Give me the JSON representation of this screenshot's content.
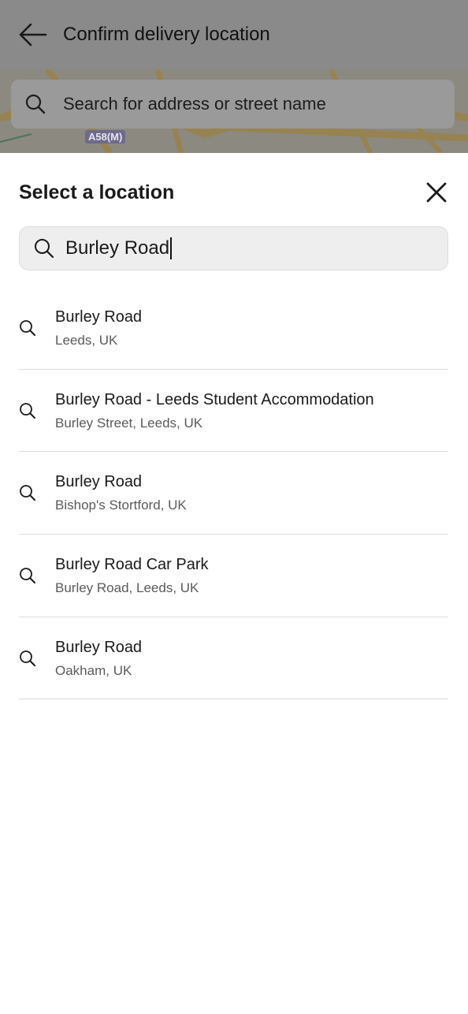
{
  "header": {
    "title": "Confirm delivery location",
    "back_icon": "arrow-left-icon"
  },
  "map": {
    "search_placeholder": "Search for address or street name",
    "road_label": "A58(M)"
  },
  "sheet": {
    "title": "Select a location",
    "close_icon": "close-icon",
    "search_value": "Burley Road"
  },
  "results": [
    {
      "title": "Burley Road",
      "subtitle": "Leeds, UK"
    },
    {
      "title": "Burley Road - Leeds Student Accommodation",
      "subtitle": "Burley Street, Leeds, UK"
    },
    {
      "title": "Burley Road",
      "subtitle": "Bishop's Stortford, UK"
    },
    {
      "title": "Burley Road Car Park",
      "subtitle": "Burley Road, Leeds, UK"
    },
    {
      "title": "Burley Road",
      "subtitle": "Oakham, UK"
    }
  ],
  "colors": {
    "overlay": "#8a8a8a",
    "sheet_bg": "#ffffff",
    "search_bg": "#eeeeee",
    "divider": "#dcdcdc"
  }
}
